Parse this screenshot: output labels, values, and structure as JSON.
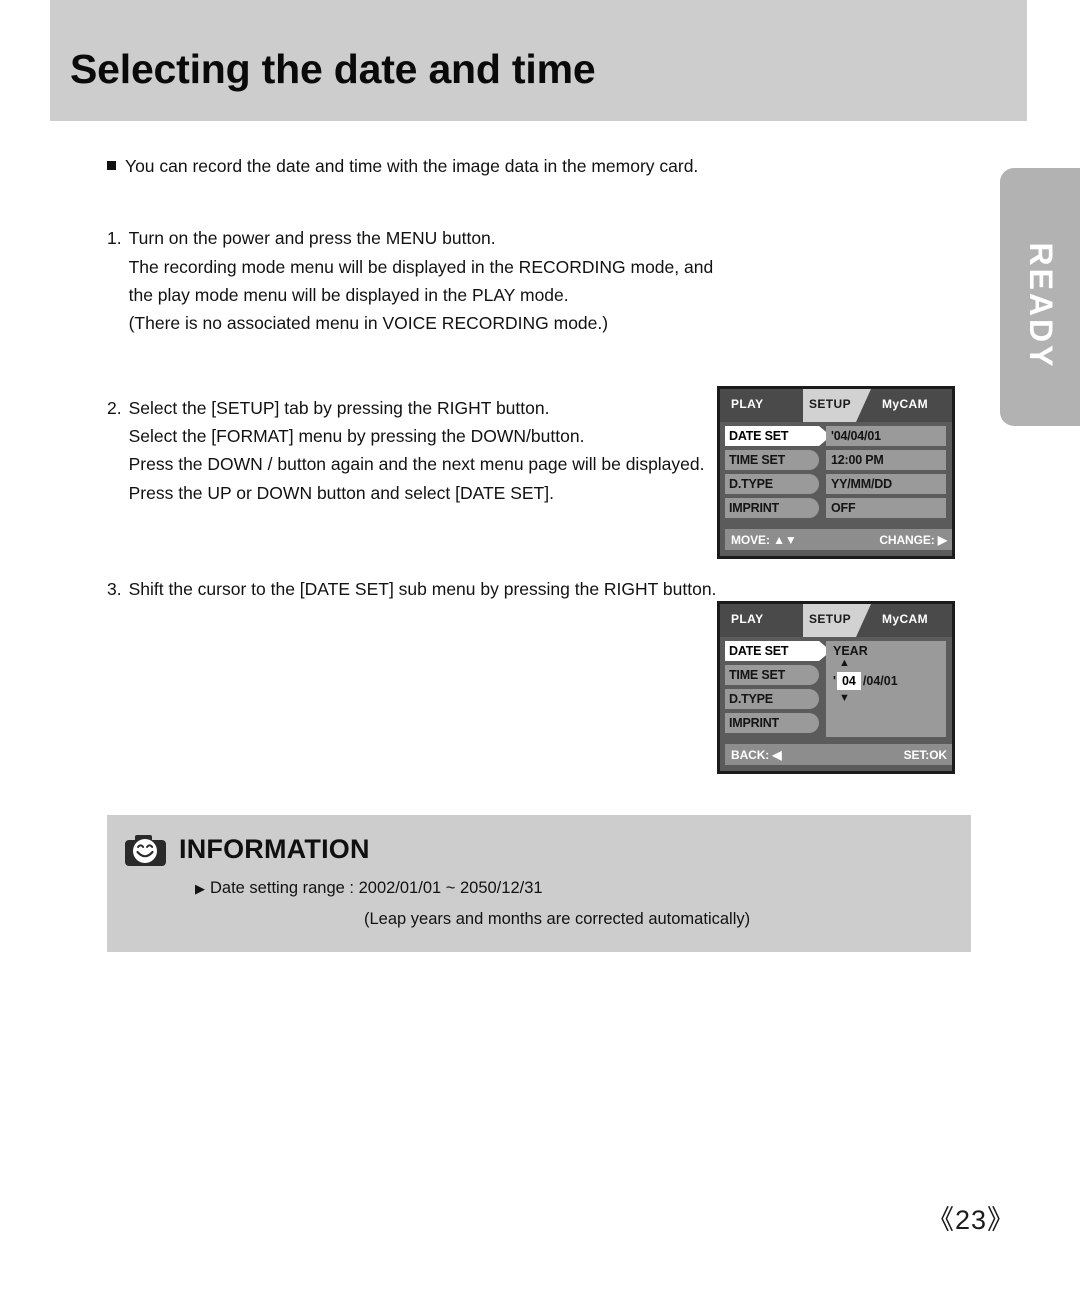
{
  "header": {
    "title": "Selecting the date and time"
  },
  "side_tab": {
    "label": "READY"
  },
  "body": {
    "bullet": "You can record the date and time with the image data in the memory card.",
    "steps": [
      {
        "number": "1.",
        "lines": [
          "Turn on the power and press the MENU button.",
          "The recording mode menu will be displayed in the RECORDING mode, and the play mode menu will be displayed in the PLAY mode.",
          "(There is no associated menu in VOICE RECORDING mode.)"
        ]
      },
      {
        "number": "2.",
        "lines": [
          "Select the [SETUP] tab by pressing the RIGHT button.",
          "Select the [FORMAT] menu by pressing the DOWN/button.",
          "Press the DOWN / button again and the next menu page will be displayed.",
          "Press the UP or DOWN button and select [DATE SET]."
        ]
      },
      {
        "number": "3.",
        "lines": [
          "Shift the cursor to the [DATE SET] sub menu by pressing the RIGHT button."
        ]
      }
    ]
  },
  "lcd_1": {
    "tabs": {
      "left": "PLAY",
      "center": "SETUP",
      "right": "MyCAM"
    },
    "menu_items": [
      "DATE SET",
      "TIME SET",
      "D.TYPE",
      "IMPRINT"
    ],
    "values": [
      "'04/04/01",
      "12:00 PM",
      "YY/MM/DD",
      "OFF"
    ],
    "active_index": 0,
    "footer": {
      "left": "MOVE: ▲▼",
      "right": "CHANGE: ▶"
    }
  },
  "lcd_2": {
    "tabs": {
      "left": "PLAY",
      "center": "SETUP",
      "right": "MyCAM"
    },
    "menu_items": [
      "DATE SET",
      "TIME SET",
      "D.TYPE",
      "IMPRINT"
    ],
    "active_index": 0,
    "sub_panel": {
      "title": "YEAR",
      "up_arrow": "▲",
      "down_arrow": "▼",
      "apostrophe": "'",
      "year_value": "04",
      "rest_of_date": "/04/01"
    },
    "footer": {
      "left": "BACK: ◀",
      "right": "SET:OK"
    }
  },
  "information": {
    "icon": "camera-smiley-icon",
    "title": "INFORMATION",
    "marker": "▶",
    "line_1": "Date setting range : 2002/01/01 ~ 2050/12/31",
    "line_2": "(Leap years and months are corrected automatically)"
  },
  "page_number": "《23》",
  "colors": {
    "band_gray": "#cdcdcd",
    "ready_tab_gray": "#b2b2b2",
    "lcd_bg": "#5b5b5b",
    "lcd_header": "#4a4a4a",
    "lcd_row": "#9a9a9a",
    "lcd_active": "#ffffff"
  }
}
